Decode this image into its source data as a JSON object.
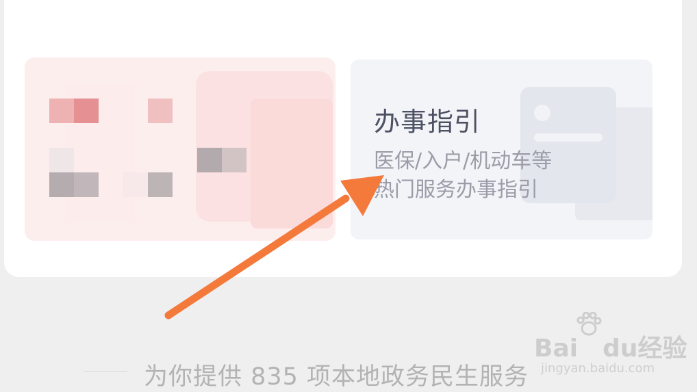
{
  "guide_card": {
    "title": "办事指引",
    "desc_line1": "医保/入户/机动车等",
    "desc_line2": "热门服务办事指引"
  },
  "footer": {
    "text": "为你提供 835 项本地政务民生服务"
  },
  "watermark": {
    "brand": "Bai",
    "brand2": "du",
    "cn": "经验",
    "url": "jingyan.baidu.com"
  },
  "annotation": {
    "arrow_color": "#f47a3c"
  },
  "icons": [
    "pixelated-service-icon",
    "guide-illustration-icon",
    "baidu-paw-icon",
    "arrow-annotation-icon"
  ]
}
